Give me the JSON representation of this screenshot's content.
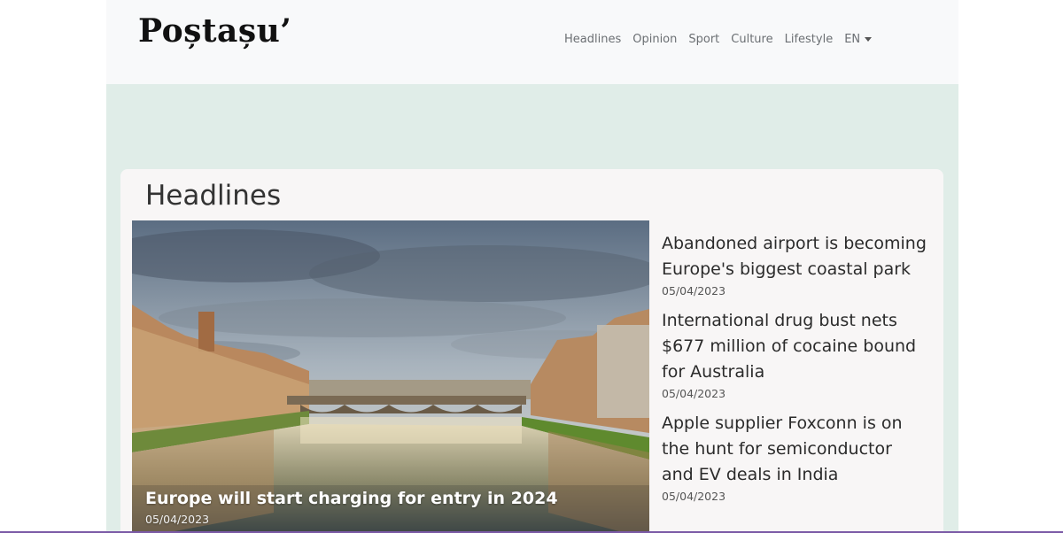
{
  "brand": {
    "name": "Poștașu’"
  },
  "nav": {
    "items": [
      "Headlines",
      "Opinion",
      "Sport",
      "Culture",
      "Lifestyle"
    ],
    "lang": "EN"
  },
  "section": {
    "title": "Headlines"
  },
  "feature": {
    "title": "Europe will start charging for entry in 2024",
    "date": "05/04/2023"
  },
  "side_articles": [
    {
      "title": "Abandoned airport is becoming Europe's biggest coastal park",
      "date": "05/04/2023"
    },
    {
      "title": "International drug bust nets $677 million of cocaine bound for Australia",
      "date": "05/04/2023"
    },
    {
      "title": "Apple supplier Foxconn is on the hunt for semiconductor and EV deals in India",
      "date": "05/04/2023"
    }
  ],
  "colors": {
    "page_bg": "#ffffff",
    "container_bg": "#e0ede8",
    "navbar_bg": "#f8f9fa",
    "card_bg": "#f8f6f6",
    "bottom_accent": "#7b5aa6"
  }
}
